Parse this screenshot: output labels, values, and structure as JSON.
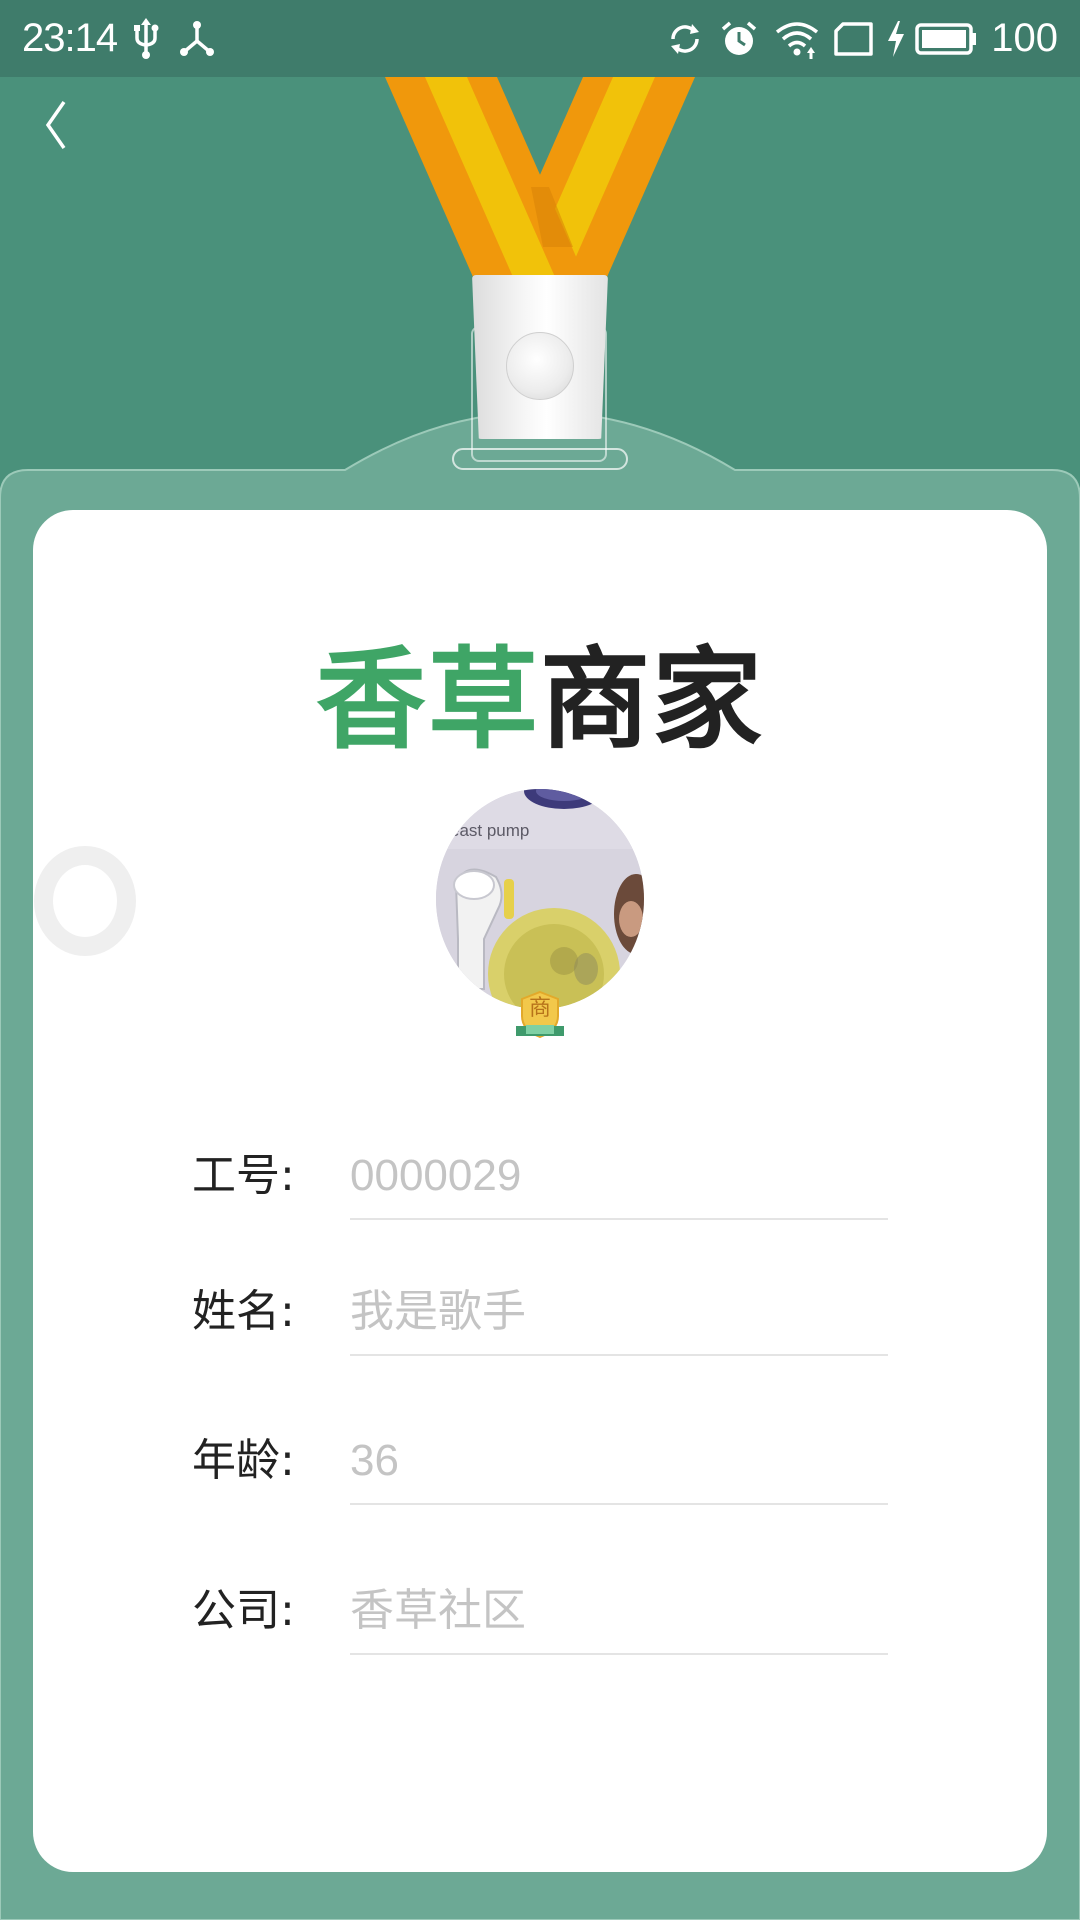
{
  "status_bar": {
    "time": "23:14",
    "left_icons": [
      "usb-icon",
      "usb-debug-icon"
    ],
    "right_icons": [
      "sync-icon",
      "alarm-icon",
      "wifi-icon",
      "sim-icon",
      "charging-icon",
      "battery-icon"
    ],
    "battery_level": "100"
  },
  "nav": {
    "back_icon": "chevron-left-icon"
  },
  "card": {
    "brand": {
      "part_green": "香草",
      "part_dark": "商家"
    },
    "avatar": {
      "photo_text": "east pump",
      "badge_text": "商"
    },
    "fields": [
      {
        "label": "工号:",
        "value": "0000029"
      },
      {
        "label": "姓名:",
        "value": "我是歌手"
      },
      {
        "label": "年龄:",
        "value": "36"
      },
      {
        "label": "公司:",
        "value": "香草社区"
      }
    ]
  },
  "colors": {
    "background": "#4a917b",
    "status_bar": "#3f7c6b",
    "card_frame": "#6ca995",
    "brand_green": "#3fa566",
    "lanyard_orange": "#f0980c",
    "lanyard_yellow": "#f1c20a"
  }
}
